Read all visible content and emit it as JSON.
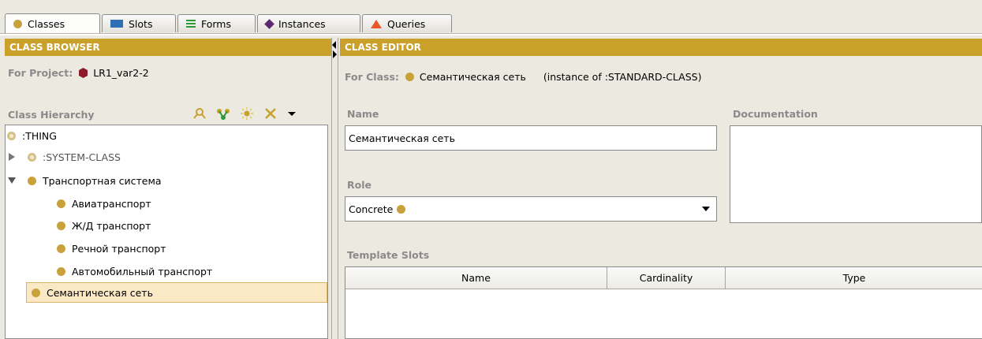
{
  "tabs": [
    {
      "label": "Classes",
      "icon": "class-icon",
      "active": true
    },
    {
      "label": "Slots",
      "icon": "slot-icon"
    },
    {
      "label": "Forms",
      "icon": "forms-icon"
    },
    {
      "label": "Instances",
      "icon": "instance-icon"
    },
    {
      "label": "Queries",
      "icon": "query-icon"
    }
  ],
  "browser": {
    "header": "CLASS BROWSER",
    "project_label": "For Project:",
    "project_name": "LR1_var2-2",
    "hierarchy_label": "Class Hierarchy",
    "tree": [
      {
        "label": ":THING"
      },
      {
        "label": ":SYSTEM-CLASS"
      },
      {
        "label": "Транспортная система"
      },
      {
        "label": "Авиатранспорт"
      },
      {
        "label": "Ж/Д транспорт"
      },
      {
        "label": "Речной транспорт"
      },
      {
        "label": "Автомобильный транспорт"
      },
      {
        "label": "Семантическая сеть",
        "selected": true
      }
    ]
  },
  "editor": {
    "header": "CLASS EDITOR",
    "for_class_label": "For Class:",
    "class_name": "Семантическая сеть",
    "instance_of": "(instance of :STANDARD-CLASS)",
    "name_label": "Name",
    "name_value": "Семантическая сеть",
    "documentation_label": "Documentation",
    "role_label": "Role",
    "role_value": "Concrete",
    "template_slots_label": "Template Slots",
    "columns": [
      "Name",
      "Cardinality",
      "Type"
    ]
  },
  "colors": {
    "header_bg": "#c9a02a",
    "class_dot": "#c8a13a",
    "project_icon": "#8b1c2b",
    "selection_bg": "#fbe9c6"
  }
}
